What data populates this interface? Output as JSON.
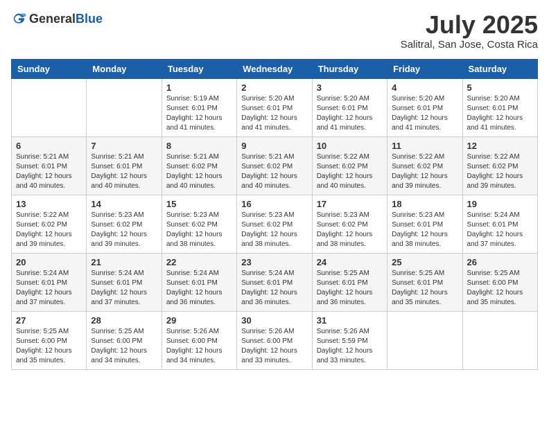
{
  "header": {
    "logo": {
      "general": "General",
      "blue": "Blue"
    },
    "month": "July 2025",
    "location": "Salitral, San Jose, Costa Rica"
  },
  "weekdays": [
    "Sunday",
    "Monday",
    "Tuesday",
    "Wednesday",
    "Thursday",
    "Friday",
    "Saturday"
  ],
  "weeks": [
    [
      {
        "day": "",
        "sunrise": "",
        "sunset": "",
        "daylight": ""
      },
      {
        "day": "",
        "sunrise": "",
        "sunset": "",
        "daylight": ""
      },
      {
        "day": "1",
        "sunrise": "Sunrise: 5:19 AM",
        "sunset": "Sunset: 6:01 PM",
        "daylight": "Daylight: 12 hours and 41 minutes."
      },
      {
        "day": "2",
        "sunrise": "Sunrise: 5:20 AM",
        "sunset": "Sunset: 6:01 PM",
        "daylight": "Daylight: 12 hours and 41 minutes."
      },
      {
        "day": "3",
        "sunrise": "Sunrise: 5:20 AM",
        "sunset": "Sunset: 6:01 PM",
        "daylight": "Daylight: 12 hours and 41 minutes."
      },
      {
        "day": "4",
        "sunrise": "Sunrise: 5:20 AM",
        "sunset": "Sunset: 6:01 PM",
        "daylight": "Daylight: 12 hours and 41 minutes."
      },
      {
        "day": "5",
        "sunrise": "Sunrise: 5:20 AM",
        "sunset": "Sunset: 6:01 PM",
        "daylight": "Daylight: 12 hours and 41 minutes."
      }
    ],
    [
      {
        "day": "6",
        "sunrise": "Sunrise: 5:21 AM",
        "sunset": "Sunset: 6:01 PM",
        "daylight": "Daylight: 12 hours and 40 minutes."
      },
      {
        "day": "7",
        "sunrise": "Sunrise: 5:21 AM",
        "sunset": "Sunset: 6:01 PM",
        "daylight": "Daylight: 12 hours and 40 minutes."
      },
      {
        "day": "8",
        "sunrise": "Sunrise: 5:21 AM",
        "sunset": "Sunset: 6:02 PM",
        "daylight": "Daylight: 12 hours and 40 minutes."
      },
      {
        "day": "9",
        "sunrise": "Sunrise: 5:21 AM",
        "sunset": "Sunset: 6:02 PM",
        "daylight": "Daylight: 12 hours and 40 minutes."
      },
      {
        "day": "10",
        "sunrise": "Sunrise: 5:22 AM",
        "sunset": "Sunset: 6:02 PM",
        "daylight": "Daylight: 12 hours and 40 minutes."
      },
      {
        "day": "11",
        "sunrise": "Sunrise: 5:22 AM",
        "sunset": "Sunset: 6:02 PM",
        "daylight": "Daylight: 12 hours and 39 minutes."
      },
      {
        "day": "12",
        "sunrise": "Sunrise: 5:22 AM",
        "sunset": "Sunset: 6:02 PM",
        "daylight": "Daylight: 12 hours and 39 minutes."
      }
    ],
    [
      {
        "day": "13",
        "sunrise": "Sunrise: 5:22 AM",
        "sunset": "Sunset: 6:02 PM",
        "daylight": "Daylight: 12 hours and 39 minutes."
      },
      {
        "day": "14",
        "sunrise": "Sunrise: 5:23 AM",
        "sunset": "Sunset: 6:02 PM",
        "daylight": "Daylight: 12 hours and 39 minutes."
      },
      {
        "day": "15",
        "sunrise": "Sunrise: 5:23 AM",
        "sunset": "Sunset: 6:02 PM",
        "daylight": "Daylight: 12 hours and 38 minutes."
      },
      {
        "day": "16",
        "sunrise": "Sunrise: 5:23 AM",
        "sunset": "Sunset: 6:02 PM",
        "daylight": "Daylight: 12 hours and 38 minutes."
      },
      {
        "day": "17",
        "sunrise": "Sunrise: 5:23 AM",
        "sunset": "Sunset: 6:02 PM",
        "daylight": "Daylight: 12 hours and 38 minutes."
      },
      {
        "day": "18",
        "sunrise": "Sunrise: 5:23 AM",
        "sunset": "Sunset: 6:01 PM",
        "daylight": "Daylight: 12 hours and 38 minutes."
      },
      {
        "day": "19",
        "sunrise": "Sunrise: 5:24 AM",
        "sunset": "Sunset: 6:01 PM",
        "daylight": "Daylight: 12 hours and 37 minutes."
      }
    ],
    [
      {
        "day": "20",
        "sunrise": "Sunrise: 5:24 AM",
        "sunset": "Sunset: 6:01 PM",
        "daylight": "Daylight: 12 hours and 37 minutes."
      },
      {
        "day": "21",
        "sunrise": "Sunrise: 5:24 AM",
        "sunset": "Sunset: 6:01 PM",
        "daylight": "Daylight: 12 hours and 37 minutes."
      },
      {
        "day": "22",
        "sunrise": "Sunrise: 5:24 AM",
        "sunset": "Sunset: 6:01 PM",
        "daylight": "Daylight: 12 hours and 36 minutes."
      },
      {
        "day": "23",
        "sunrise": "Sunrise: 5:24 AM",
        "sunset": "Sunset: 6:01 PM",
        "daylight": "Daylight: 12 hours and 36 minutes."
      },
      {
        "day": "24",
        "sunrise": "Sunrise: 5:25 AM",
        "sunset": "Sunset: 6:01 PM",
        "daylight": "Daylight: 12 hours and 36 minutes."
      },
      {
        "day": "25",
        "sunrise": "Sunrise: 5:25 AM",
        "sunset": "Sunset: 6:01 PM",
        "daylight": "Daylight: 12 hours and 35 minutes."
      },
      {
        "day": "26",
        "sunrise": "Sunrise: 5:25 AM",
        "sunset": "Sunset: 6:00 PM",
        "daylight": "Daylight: 12 hours and 35 minutes."
      }
    ],
    [
      {
        "day": "27",
        "sunrise": "Sunrise: 5:25 AM",
        "sunset": "Sunset: 6:00 PM",
        "daylight": "Daylight: 12 hours and 35 minutes."
      },
      {
        "day": "28",
        "sunrise": "Sunrise: 5:25 AM",
        "sunset": "Sunset: 6:00 PM",
        "daylight": "Daylight: 12 hours and 34 minutes."
      },
      {
        "day": "29",
        "sunrise": "Sunrise: 5:26 AM",
        "sunset": "Sunset: 6:00 PM",
        "daylight": "Daylight: 12 hours and 34 minutes."
      },
      {
        "day": "30",
        "sunrise": "Sunrise: 5:26 AM",
        "sunset": "Sunset: 6:00 PM",
        "daylight": "Daylight: 12 hours and 33 minutes."
      },
      {
        "day": "31",
        "sunrise": "Sunrise: 5:26 AM",
        "sunset": "Sunset: 5:59 PM",
        "daylight": "Daylight: 12 hours and 33 minutes."
      },
      {
        "day": "",
        "sunrise": "",
        "sunset": "",
        "daylight": ""
      },
      {
        "day": "",
        "sunrise": "",
        "sunset": "",
        "daylight": ""
      }
    ]
  ]
}
